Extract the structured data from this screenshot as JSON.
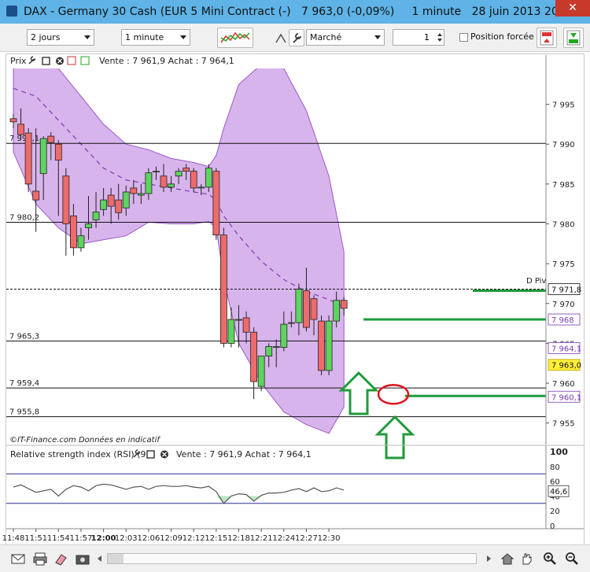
{
  "window": {
    "title": "DAX - Germany 30 Cash (EUR 5 Mini Contract (-)   7 963,0 (-0,09%)     1 minute   28 juin 2013 20...",
    "close_label": "✕"
  },
  "toolbar": {
    "period": "2 jours",
    "interval": "1 minute",
    "order_type": "Marché",
    "quantity": "1",
    "forced_position_label": "Position forcée"
  },
  "chart": {
    "header_label": "Prix",
    "header_quote": "Vente : 7 961,9 Achat : 7 964,1",
    "copyright": "©IT-Finance.com  Données en indicatif",
    "pivot_label": "D Piv",
    "price_axis": [
      "7 995",
      "7 990",
      "7 985",
      "7 980",
      "7 975",
      "7 970",
      "7 965",
      "7 960",
      "7 955"
    ],
    "level_labels": [
      "7 990,1",
      "7 980,2",
      "7 965,3",
      "7 959,4",
      "7 955,8"
    ],
    "tags": {
      "pivot": "7 971,8",
      "resistance": "7 968",
      "ask": "7 964,1",
      "last": "7 963,0",
      "bid": "7 960,1"
    },
    "time_axis": [
      "11:48",
      "11:51",
      "11:54",
      "11:57",
      "12:00",
      "12:03",
      "12:06",
      "12:09",
      "12:12",
      "12:15",
      "12:18",
      "12:21",
      "12:24",
      "12:27",
      "12:30"
    ],
    "colors": {
      "bull": "#5fd35f",
      "bear": "#ee6b6b",
      "band": "#d8b4ec",
      "band_line": "#9b59c8",
      "annotation": "#1f9b3a",
      "marker": "#e0141e"
    }
  },
  "rsi": {
    "header_label": "Relative strength index (RSI) (9)",
    "header_quote": "Vente : 7 961,9 Achat : 7 964,1",
    "axis": [
      "100",
      "80",
      "60",
      "40",
      "20",
      "0"
    ],
    "value_tag": "46,6"
  },
  "chart_data": {
    "type": "candlestick",
    "x": [
      "11:48",
      "11:49",
      "11:50",
      "11:51",
      "11:52",
      "11:53",
      "11:54",
      "11:55",
      "11:56",
      "11:57",
      "11:58",
      "11:59",
      "12:00",
      "12:01",
      "12:02",
      "12:03",
      "12:04",
      "12:05",
      "12:06",
      "12:07",
      "12:08",
      "12:09",
      "12:10",
      "12:11",
      "12:12",
      "12:13",
      "12:14",
      "12:15",
      "12:16",
      "12:17",
      "12:18",
      "12:19",
      "12:20",
      "12:21",
      "12:22",
      "12:23",
      "12:24",
      "12:25",
      "12:26",
      "12:27",
      "12:28",
      "12:29",
      "12:30",
      "12:31",
      "12:32"
    ],
    "open": [
      7993.2,
      7992.5,
      7991.4,
      7984.1,
      7986.3,
      7991.0,
      7990.0,
      7986.0,
      7981.0,
      7977.0,
      7979.5,
      7980.5,
      7981.8,
      7983.6,
      7983.0,
      7982.0,
      7984.5,
      7983.6,
      7983.8,
      7986.6,
      7986.0,
      7984.6,
      7986.0,
      7987.0,
      7986.6,
      7984.6,
      7984.6,
      7986.6,
      7978.6,
      7965.0,
      7968.0,
      7968.2,
      7966.4,
      7959.6,
      7963.4,
      7964.6,
      7964.5,
      7967.6,
      7967.6,
      7971.6,
      7970.6,
      7967.8,
      7961.6,
      7967.8,
      7970.4
    ],
    "close": [
      7992.8,
      7991.2,
      7985.0,
      7983.0,
      7990.7,
      7990.2,
      7988.0,
      7980.0,
      7977.0,
      7978.5,
      7980.0,
      7981.5,
      7983.0,
      7982.2,
      7981.4,
      7984.0,
      7983.8,
      7983.8,
      7986.4,
      7986.6,
      7984.6,
      7985.0,
      7986.6,
      7986.6,
      7984.5,
      7984.6,
      7987.0,
      7978.6,
      7965.0,
      7968.0,
      7968.0,
      7966.4,
      7960.2,
      7963.4,
      7964.6,
      7964.6,
      7967.4,
      7967.6,
      7971.8,
      7967.0,
      7968.0,
      7961.6,
      7967.8,
      7970.4,
      7969.4
    ],
    "high": [
      7993.8,
      7994.5,
      7992.0,
      7992.0,
      7991.0,
      7991.5,
      7990.5,
      7987.0,
      7982.5,
      7979.5,
      7983.5,
      7984.0,
      7984.5,
      7984.5,
      7985.0,
      7984.8,
      7985.5,
      7985.0,
      7987.0,
      7987.2,
      7987.5,
      7986.0,
      7987.0,
      7987.5,
      7987.0,
      7985.0,
      7987.5,
      7987.0,
      7979.5,
      7969.5,
      7969.8,
      7969.0,
      7967.0,
      7962.0,
      7965.0,
      7965.5,
      7969.0,
      7969.0,
      7972.5,
      7974.5,
      7971.0,
      7968.5,
      7968.5,
      7971.5,
      7970.8
    ],
    "low": [
      7992.0,
      7990.5,
      7984.0,
      7979.0,
      7983.0,
      7988.0,
      7981.0,
      7976.0,
      7976.0,
      7976.5,
      7978.0,
      7979.5,
      7981.0,
      7980.0,
      7980.5,
      7981.0,
      7982.5,
      7982.5,
      7983.0,
      7985.5,
      7984.0,
      7984.0,
      7985.0,
      7985.5,
      7984.0,
      7983.6,
      7984.0,
      7978.0,
      7964.5,
      7964.5,
      7964.5,
      7965.0,
      7958.0,
      7959.0,
      7962.0,
      7962.0,
      7964.0,
      7967.0,
      7966.0,
      7966.5,
      7966.0,
      7961.0,
      7961.0,
      7967.0,
      7968.5
    ],
    "ylim": [
      7952.5,
      7999.5
    ],
    "levels": [
      7990.1,
      7980.2,
      7971.8,
      7965.3,
      7959.4,
      7955.8
    ],
    "bollinger": {
      "x": [
        "11:48",
        "11:51",
        "11:54",
        "11:57",
        "12:00",
        "12:03",
        "12:06",
        "12:09",
        "12:12",
        "12:14",
        "12:15",
        "12:16",
        "12:18",
        "12:21",
        "12:24",
        "12:27",
        "12:30",
        "12:32"
      ],
      "upper": [
        8002.0,
        8002.0,
        7999.5,
        7996.0,
        7992.5,
        7990.0,
        7989.3,
        7988.2,
        7987.7,
        7987.2,
        7988.6,
        7992.0,
        7997.5,
        8000.0,
        7999.5,
        7994.2,
        7986.0,
        7976.5
      ],
      "mid": [
        7997.0,
        7996.0,
        7993.0,
        7990.0,
        7987.0,
        7985.5,
        7985.0,
        7984.5,
        7984.0,
        7983.7,
        7983.0,
        7981.0,
        7978.5,
        7975.3,
        7973.0,
        7971.5,
        7970.5,
        7969.5
      ],
      "lower": [
        7989.0,
        7982.5,
        7979.5,
        7977.5,
        7978.0,
        7978.5,
        7980.2,
        7980.0,
        7980.0,
        7980.3,
        7979.5,
        7973.0,
        7965.0,
        7960.0,
        7956.4,
        7954.8,
        7953.7,
        7957.0
      ]
    },
    "rsi": {
      "values": [
        52,
        55,
        50,
        45,
        47,
        49,
        40,
        49,
        54,
        52,
        47,
        54,
        56,
        55,
        52,
        49,
        52,
        53,
        49,
        53,
        54,
        53,
        53,
        54,
        52,
        51,
        53,
        46,
        30,
        40,
        43,
        42,
        33,
        41,
        44,
        44,
        45,
        48,
        50,
        46,
        51,
        46,
        47,
        51,
        48
      ],
      "ylim": [
        0,
        100
      ],
      "levels": [
        70,
        30
      ]
    }
  }
}
